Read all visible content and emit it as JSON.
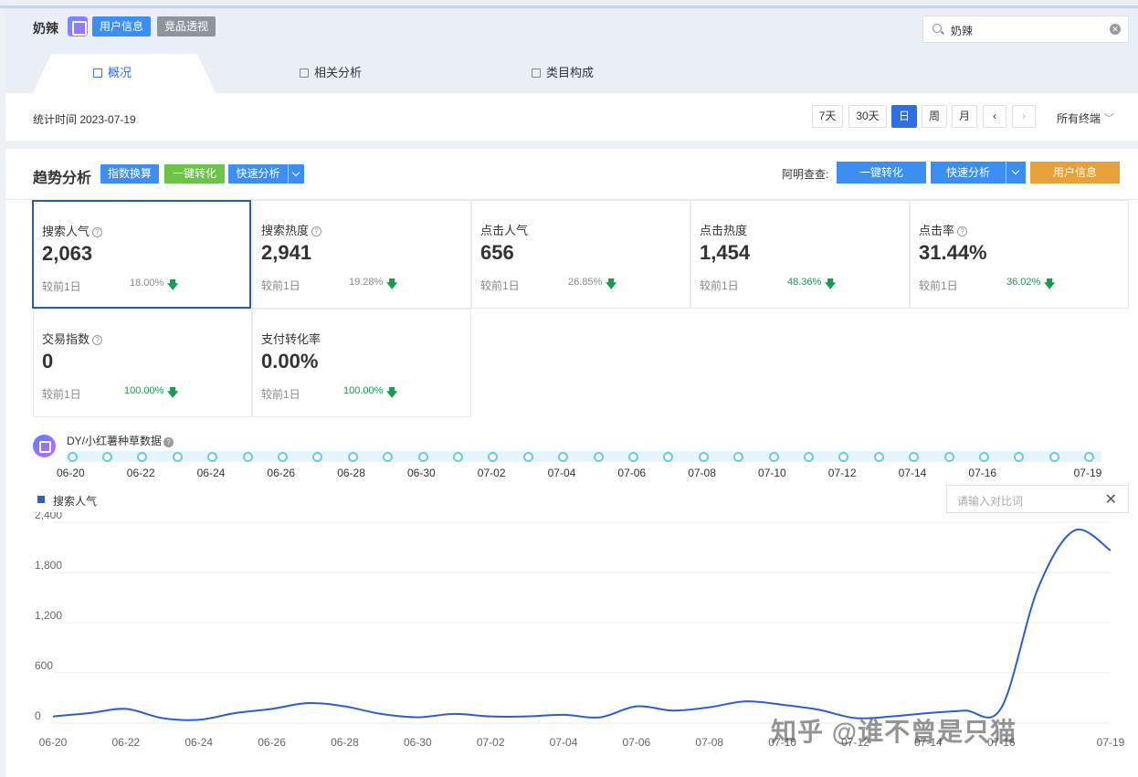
{
  "header": {
    "keyword": "奶辣",
    "tag_user": "用户信息",
    "tag_compete": "竞品透视",
    "search_value": "奶辣",
    "tabs": [
      {
        "label": "概况"
      },
      {
        "label": "相关分析"
      },
      {
        "label": "类目构成"
      }
    ],
    "stat_time": "统计时间 2023-07-19",
    "ranges": [
      "7天",
      "30天",
      "日",
      "周",
      "月"
    ],
    "active_range": "日",
    "terminal": "所有终端"
  },
  "trend": {
    "title": "趋势分析",
    "btn_index": "指数换算",
    "btn_convert": "一键转化",
    "btn_quick": "快速分析",
    "ming_label": "阿明查查:",
    "right_convert": "一键转化",
    "right_quick": "快速分析",
    "right_user": "用户信息"
  },
  "metrics": [
    {
      "name": "搜索人气",
      "value": "2,063",
      "compare": "较前1日",
      "pct": "18.00%",
      "pct_color": "#888888",
      "help": true
    },
    {
      "name": "搜索热度",
      "value": "2,941",
      "compare": "较前1日",
      "pct": "19.28%",
      "pct_color": "#888888",
      "help": true
    },
    {
      "name": "点击人气",
      "value": "656",
      "compare": "较前1日",
      "pct": "26.85%",
      "pct_color": "#888888",
      "help": false
    },
    {
      "name": "点击热度",
      "value": "1,454",
      "compare": "较前1日",
      "pct": "48.36%",
      "pct_color": "#1a9a52",
      "help": false
    },
    {
      "name": "点击率",
      "value": "31.44%",
      "compare": "较前1日",
      "pct": "36.02%",
      "pct_color": "#1a9a52",
      "help": true
    },
    {
      "name": "交易指数",
      "value": "0",
      "compare": "较前1日",
      "pct": "100.00%",
      "pct_color": "#1a9a52",
      "help": true
    },
    {
      "name": "支付转化率",
      "value": "0.00%",
      "compare": "较前1日",
      "pct": "100.00%",
      "pct_color": "#1a9a52",
      "help": false
    }
  ],
  "dy": {
    "label": "DY/小红薯种草数据",
    "timeline_labels": [
      "06-20",
      "06-22",
      "06-24",
      "06-26",
      "06-28",
      "06-30",
      "07-02",
      "07-04",
      "07-06",
      "07-08",
      "07-10",
      "07-12",
      "07-14",
      "07-16",
      "07-19"
    ]
  },
  "compare_input": {
    "placeholder": "请输入对比词"
  },
  "watermark": "知乎 @谁不曾是只猫",
  "chart_data": {
    "type": "line",
    "x": [
      "06-20",
      "06-21",
      "06-22",
      "06-23",
      "06-24",
      "06-25",
      "06-26",
      "06-27",
      "06-28",
      "06-29",
      "06-30",
      "07-01",
      "07-02",
      "07-03",
      "07-04",
      "07-05",
      "07-06",
      "07-07",
      "07-08",
      "07-09",
      "07-10",
      "07-11",
      "07-12",
      "07-13",
      "07-14",
      "07-15",
      "07-16",
      "07-17",
      "07-18",
      "07-19"
    ],
    "x_tick_labels": [
      "06-20",
      "06-22",
      "06-24",
      "06-26",
      "06-28",
      "06-30",
      "07-02",
      "07-04",
      "07-06",
      "07-08",
      "07-10",
      "07-12",
      "07-14",
      "07-16",
      "07-19"
    ],
    "series": [
      {
        "name": "搜索人气",
        "color": "#2f5fc4",
        "values": [
          80,
          120,
          170,
          60,
          40,
          120,
          170,
          240,
          200,
          110,
          70,
          110,
          80,
          80,
          100,
          70,
          200,
          150,
          190,
          260,
          220,
          160,
          60,
          80,
          120,
          150,
          180,
          1600,
          2300,
          2063
        ]
      }
    ],
    "ylim": [
      0,
      2400
    ],
    "yticks": [
      0,
      600,
      1200,
      1800,
      2400
    ],
    "ytick_labels": [
      "0",
      "600",
      "1,200",
      "1,800",
      "2,400"
    ],
    "grid": true,
    "legend": "top-left"
  }
}
